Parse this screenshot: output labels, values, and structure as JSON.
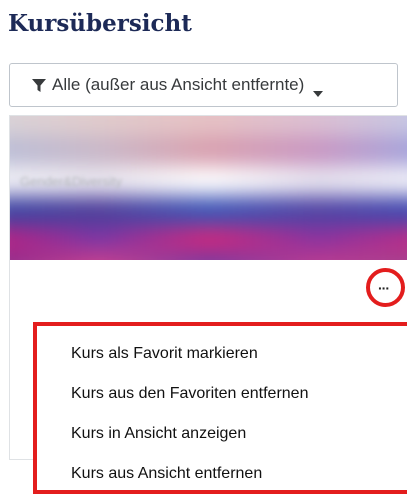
{
  "page": {
    "title": "Kursübersicht"
  },
  "filter": {
    "label": "Alle (außer aus Ansicht entfernte)"
  },
  "course": {
    "name": "Gender&Diversity"
  },
  "actions": {
    "more_label": "···"
  },
  "menu": {
    "items": [
      {
        "label": "Kurs als Favorit markieren"
      },
      {
        "label": "Kurs aus den Favoriten entfernen"
      },
      {
        "label": "Kurs in Ansicht anzeigen"
      },
      {
        "label": "Kurs aus Ansicht entfernen"
      }
    ]
  },
  "colors": {
    "highlight": "#e31d1d",
    "title": "#1d2a57"
  }
}
